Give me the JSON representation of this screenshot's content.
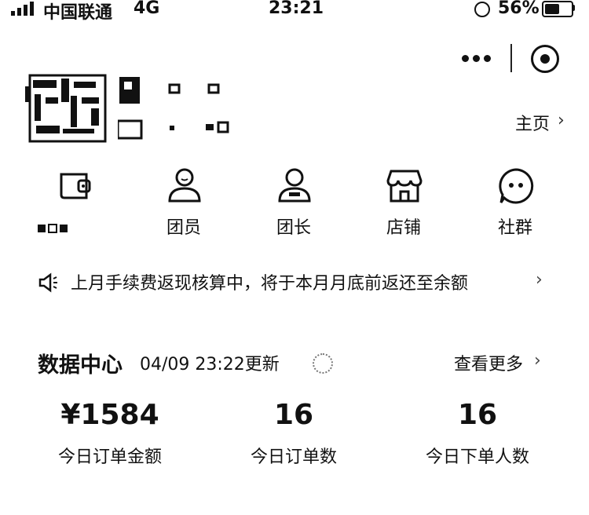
{
  "status_bar": {
    "carrier": "中国联通",
    "network": "4G",
    "time": "23:21",
    "battery_percent": "56%",
    "battery_level": 0.56
  },
  "header": {
    "home_link": "主页",
    "chevron": "›"
  },
  "nav": {
    "items": [
      {
        "label": "",
        "icon": "wallet-icon"
      },
      {
        "label": "团员",
        "icon": "member-icon"
      },
      {
        "label": "团长",
        "icon": "leader-icon"
      },
      {
        "label": "店铺",
        "icon": "store-icon"
      },
      {
        "label": "社群",
        "icon": "community-icon"
      }
    ]
  },
  "notice": {
    "text": "上月手续费返现核算中，将于本月月底前返还至余额",
    "chevron": "›"
  },
  "data_center": {
    "title": "数据中心",
    "updated": "04/09 23:22更新",
    "more_link": "查看更多",
    "chevron": "›",
    "stats": [
      {
        "value": "¥1584",
        "label": "今日订单金额"
      },
      {
        "value": "16",
        "label": "今日订单数"
      },
      {
        "value": "16",
        "label": "今日下单人数"
      }
    ]
  }
}
